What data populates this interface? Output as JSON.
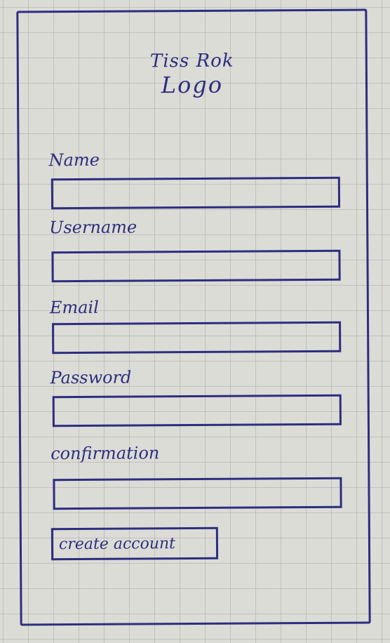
{
  "app": {
    "logo_line1": "Tiss Rok",
    "logo_line2": "Logo"
  },
  "form": {
    "fields": [
      {
        "label": "Name",
        "value": "",
        "placeholder": ""
      },
      {
        "label": "Username",
        "value": "",
        "placeholder": ""
      },
      {
        "label": "Email",
        "value": "",
        "placeholder": ""
      },
      {
        "label": "Password",
        "value": "",
        "placeholder": ""
      },
      {
        "label": "confirmation",
        "value": "",
        "placeholder": ""
      }
    ],
    "submit_label": "create account"
  },
  "colors": {
    "ink": "#2d2d80",
    "paper": "#dcdcd6"
  }
}
